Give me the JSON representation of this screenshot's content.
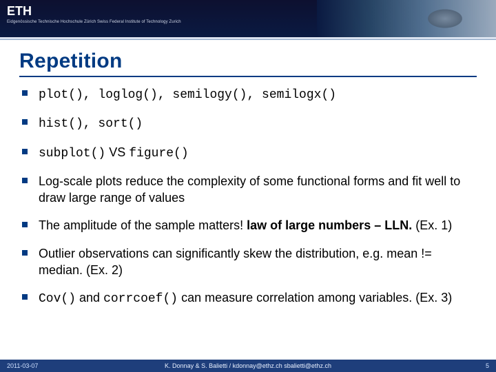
{
  "header": {
    "logo_text": "ETH",
    "logo_subtitle": "Eidgenössische Technische Hochschule Zürich  Swiss Federal Institute of Technology Zurich"
  },
  "slide": {
    "title": "Repetition",
    "bullets": [
      {
        "type": "mono",
        "text": "plot(), loglog(), semilogy(), semilogx()"
      },
      {
        "type": "mono",
        "text": "hist(), sort()"
      },
      {
        "type": "mixed",
        "parts": [
          {
            "style": "mono",
            "text": "subplot()"
          },
          {
            "style": "normal",
            "text": " VS "
          },
          {
            "style": "mono",
            "text": "figure()"
          }
        ]
      },
      {
        "type": "normal",
        "text": "Log-scale plots reduce the complexity of some functional forms and fit well to draw large range of values"
      },
      {
        "type": "mixed",
        "parts": [
          {
            "style": "normal",
            "text": "The amplitude of the sample matters! "
          },
          {
            "style": "bold",
            "text": "law of large numbers – LLN."
          },
          {
            "style": "normal",
            "text": " (Ex. 1)"
          }
        ]
      },
      {
        "type": "normal",
        "text": "Outlier observations can significantly skew the distribution, e.g. mean != median. (Ex. 2)"
      },
      {
        "type": "mixed",
        "parts": [
          {
            "style": "mono",
            "text": "Cov()"
          },
          {
            "style": "normal",
            "text": "  and "
          },
          {
            "style": "mono",
            "text": "corrcoef()"
          },
          {
            "style": "normal",
            "text": " can measure correlation among variables. (Ex. 3)"
          }
        ]
      }
    ]
  },
  "footer": {
    "date": "2011-03-07",
    "center": "K. Donnay & S. Balietti / kdonnay@ethz.ch   sbalietti@ethz.ch",
    "page": "5"
  }
}
